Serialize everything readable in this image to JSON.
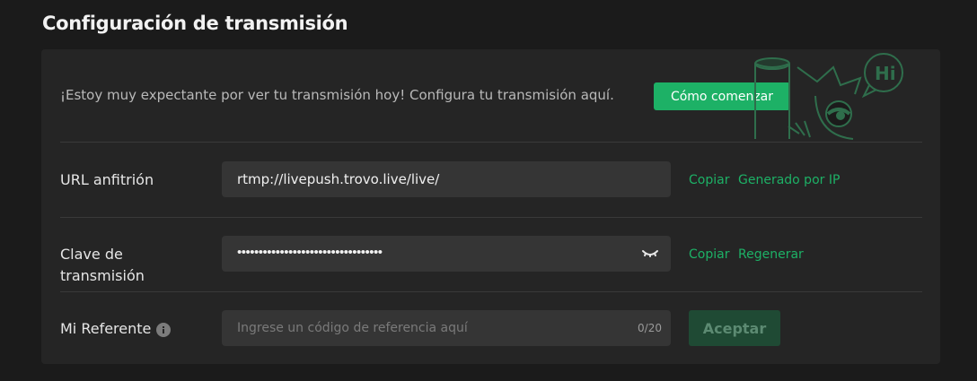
{
  "page": {
    "title": "Configuración de transmisión"
  },
  "intro": {
    "text": "¡Estoy muy expectante por ver tu transmisión hoy! Configura tu transmisión aquí.",
    "start_button": "Cómo comenzar",
    "mascot_bubble_text": "Hi"
  },
  "host_url": {
    "label": "URL anfitrión",
    "value": "rtmp://livepush.trovo.live/live/",
    "copy_label": "Copiar",
    "ip_label": "Generado por IP"
  },
  "stream_key": {
    "label_line1": "Clave de",
    "label_line2": "transmisión",
    "masked_value": "••••••••••••••••••••••••••••••••••",
    "copy_label": "Copiar",
    "regenerate_label": "Regenerar",
    "reveal_icon": "eye-closed-icon"
  },
  "referral": {
    "label": "Mi Referente",
    "info_icon": "info-icon",
    "placeholder": "Ingrese un código de referencia aquí",
    "counter": "0/20",
    "accept_label": "Aceptar"
  },
  "colors": {
    "background": "#1b1b1b",
    "panel": "#252525",
    "accent": "#1db166",
    "field": "#353535",
    "disabled_button": "#1f4a34"
  }
}
